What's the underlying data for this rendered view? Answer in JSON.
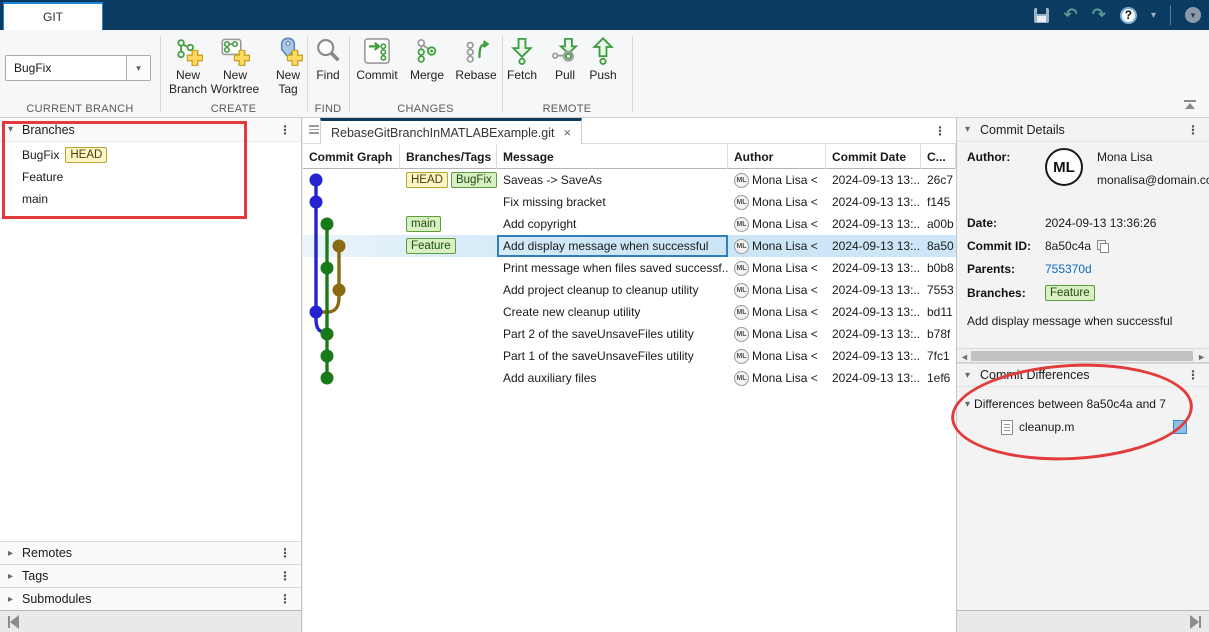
{
  "glyphs": {
    "kebab": "⋮",
    "caret_down": "▾",
    "caret_right": "▸",
    "undo": "↶",
    "redo": "↷",
    "help": "?",
    "close": "×",
    "combo_arrow": "▼",
    "hs_left": "◄",
    "hs_right": "►"
  },
  "titlebar": {
    "tab_label": "GIT"
  },
  "ribbon": {
    "current_branch_value": "BugFix",
    "group_labels": {
      "current_branch": "CURRENT BRANCH",
      "create": "CREATE",
      "find": "FIND",
      "changes": "CHANGES",
      "remote": "REMOTE"
    },
    "buttons": {
      "new_branch": "New\nBranch",
      "new_worktree": "New\nWorktree",
      "new_tag": "New\nTag",
      "find": "Find",
      "commit": "Commit",
      "merge": "Merge",
      "rebase": "Rebase",
      "fetch": "Fetch",
      "pull": "Pull",
      "push": "Push"
    }
  },
  "left_panel": {
    "branches_title": "Branches",
    "branch_items": [
      {
        "name": "BugFix",
        "badge": "HEAD"
      },
      {
        "name": "Feature"
      },
      {
        "name": "main"
      }
    ],
    "remotes_title": "Remotes",
    "tags_title": "Tags",
    "submodules_title": "Submodules"
  },
  "document": {
    "tab_title": "RebaseGitBranchInMATLABExample.git",
    "columns": [
      "Commit Graph",
      "Branches/Tags",
      "Message",
      "Author",
      "Commit Date",
      "C..."
    ],
    "avatar_initials": "ML",
    "rows": [
      {
        "badges": [
          "HEAD",
          "BugFix"
        ],
        "message": "Saveas -> SaveAs",
        "author": "Mona Lisa <",
        "date": "2024-09-13 13:...",
        "id": "26c7"
      },
      {
        "badges": [],
        "message": "Fix missing bracket",
        "author": "Mona Lisa <",
        "date": "2024-09-13 13:...",
        "id": "f145"
      },
      {
        "badges": [
          "main"
        ],
        "message": "Add copyright",
        "author": "Mona Lisa <",
        "date": "2024-09-13 13:...",
        "id": "a00b"
      },
      {
        "badges": [
          "Feature"
        ],
        "message": "Add display message when successful",
        "author": "Mona Lisa <",
        "date": "2024-09-13 13:...",
        "id": "8a50"
      },
      {
        "badges": [],
        "message": "Print message when files saved successf...",
        "author": "Mona Lisa <",
        "date": "2024-09-13 13:...",
        "id": "b0b8"
      },
      {
        "badges": [],
        "message": "Add project cleanup to cleanup utility",
        "author": "Mona Lisa <",
        "date": "2024-09-13 13:...",
        "id": "7553"
      },
      {
        "badges": [],
        "message": "Create new cleanup utility",
        "author": "Mona Lisa <",
        "date": "2024-09-13 13:...",
        "id": "bd11"
      },
      {
        "badges": [],
        "message": "Part 2 of the saveUnsaveFiles utility",
        "author": "Mona Lisa <",
        "date": "2024-09-13 13:...",
        "id": "b78f"
      },
      {
        "badges": [],
        "message": "Part 1 of the saveUnsaveFiles utility",
        "author": "Mona Lisa <",
        "date": "2024-09-13 13:...",
        "id": "7fc1"
      },
      {
        "badges": [],
        "message": "Add auxiliary files",
        "author": "Mona Lisa <",
        "date": "2024-09-13 13:...",
        "id": "1ef6"
      }
    ],
    "graph": {
      "colors": {
        "blue": "#2323d2",
        "green": "#1a7a1a",
        "brown": "#8a6a15"
      },
      "dots": [
        {
          "row": 0,
          "lane": 0,
          "color": "blue"
        },
        {
          "row": 1,
          "lane": 0,
          "color": "blue"
        },
        {
          "row": 2,
          "lane": 1,
          "color": "green"
        },
        {
          "row": 3,
          "lane": 2,
          "color": "brown"
        },
        {
          "row": 4,
          "lane": 1,
          "color": "green"
        },
        {
          "row": 5,
          "lane": 2,
          "color": "brown"
        },
        {
          "row": 6,
          "lane": 0,
          "color": "blue"
        },
        {
          "row": 7,
          "lane": 1,
          "color": "green"
        },
        {
          "row": 8,
          "lane": 1,
          "color": "green"
        },
        {
          "row": 9,
          "lane": 1,
          "color": "green"
        }
      ]
    }
  },
  "right_panel": {
    "details": {
      "title": "Commit Details",
      "author_label": "Author:",
      "author_name": "Mona Lisa",
      "author_email": "monalisa@domain.com",
      "date_label": "Date:",
      "date_value": "2024-09-13 13:36:26",
      "commit_id_label": "Commit ID:",
      "commit_id_value": "8a50c4a",
      "parents_label": "Parents:",
      "parents_value": "755370d",
      "branches_label": "Branches:",
      "branch_badge": "Feature",
      "message": "Add display message when successful"
    },
    "differences": {
      "title": "Commit Differences",
      "group_label": "Differences between 8a50c4a and 7",
      "file_name": "cleanup.m"
    }
  }
}
